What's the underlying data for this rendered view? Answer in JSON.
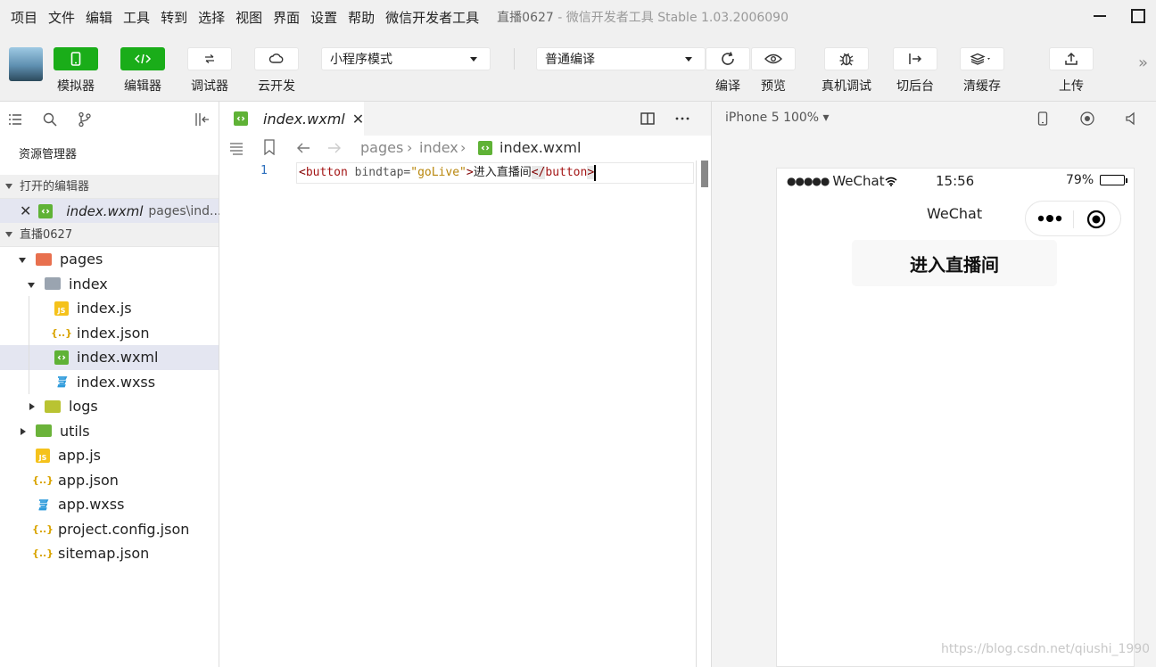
{
  "menu": {
    "items": [
      "项目",
      "文件",
      "编辑",
      "工具",
      "转到",
      "选择",
      "视图",
      "界面",
      "设置",
      "帮助",
      "微信开发者工具"
    ],
    "window_title_project": "直播0627",
    "window_title_app": "- 微信开发者工具 Stable 1.03.2006090"
  },
  "toolbar": {
    "simulator": "模拟器",
    "editor": "编辑器",
    "debugger": "调试器",
    "cloud": "云开发",
    "mode_select": "小程序模式",
    "compile_select": "普通编译",
    "compile": "编译",
    "preview": "预览",
    "real_debug": "真机调试",
    "background": "切后台",
    "clear_cache": "清缓存",
    "upload": "上传"
  },
  "sidebar": {
    "title": "资源管理器",
    "open_editors_header": "打开的编辑器",
    "open_file": {
      "name": "index.wxml",
      "path": "pages\\ind..."
    },
    "project_header": "直播0627",
    "tree": {
      "pages": "pages",
      "index": "index",
      "index_js": "index.js",
      "index_json": "index.json",
      "index_wxml": "index.wxml",
      "index_wxss": "index.wxss",
      "logs": "logs",
      "utils": "utils",
      "app_js": "app.js",
      "app_json": "app.json",
      "app_wxss": "app.wxss",
      "project_config": "project.config.json",
      "sitemap": "sitemap.json"
    }
  },
  "editor": {
    "tab_name": "index.wxml",
    "breadcrumb": {
      "seg1": "pages",
      "seg2": "index",
      "seg3": "index.wxml"
    },
    "line_number": "1",
    "code": {
      "open_lt": "<",
      "tag": "button",
      "attr": " bindtap=",
      "value": "\"goLive\"",
      "open_gt": ">",
      "text": "进入直播间",
      "close_lt": "</",
      "close_tag": "button",
      "close_gt": ">"
    }
  },
  "simulator": {
    "device": "iPhone 5 100% ▾",
    "status": {
      "carrier": "WeChat",
      "time": "15:56",
      "battery": "79%"
    },
    "battery_level": 0.79,
    "nav_title": "WeChat",
    "button_label": "进入直播间"
  },
  "watermark": "https://blog.csdn.net/qiushi_1990",
  "colors": {
    "accent_green": "#1aad19",
    "selection": "#e4e6f1"
  }
}
